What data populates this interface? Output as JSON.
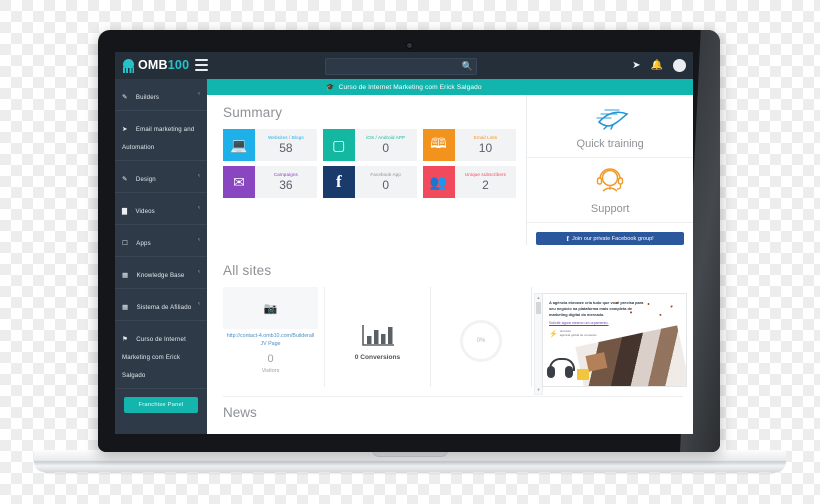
{
  "brand": {
    "name_main": "OMB",
    "name_accent": "100",
    "accent_color": "#25c3c9"
  },
  "topbar": {
    "menu_icon": "hamburger-icon",
    "search_placeholder": "",
    "search_value": "",
    "search_icon": "search-icon",
    "send_icon": "paper-plane-icon",
    "bell_icon": "bell-icon",
    "avatar_icon": "user-avatar-icon"
  },
  "notice": {
    "icon": "graduation-cap-icon",
    "text": "Curso de Internet Marketing com Erick Salgado",
    "bg_color": "#12b5ad"
  },
  "sidebar": {
    "items": [
      {
        "label": "Builders",
        "icon": "pencil-icon",
        "chevron": "‹"
      },
      {
        "label": "Email marketing and Automation",
        "icon": "paper-plane-icon",
        "chevron": ""
      },
      {
        "label": "Design",
        "icon": "pencil-icon",
        "chevron": "‹"
      },
      {
        "label": "Videos",
        "icon": "video-camera-icon",
        "chevron": "‹"
      },
      {
        "label": "Apps",
        "icon": "mobile-icon",
        "chevron": "‹"
      },
      {
        "label": "Knowledge Base",
        "icon": "book-icon",
        "chevron": "‹"
      },
      {
        "label": "Sistema de Afiliado",
        "icon": "building-icon",
        "chevron": "‹"
      },
      {
        "label": "Curso de Internet Marketing com Erick Salgado",
        "icon": "flag-icon",
        "chevron": ""
      }
    ],
    "franchise_button": "Franchise Panel",
    "franchise_color": "#14b5ac"
  },
  "summary": {
    "title": "Summary",
    "cards": [
      {
        "title": "Websites / Blogs",
        "value": "58",
        "icon": "laptop-icon",
        "color": "#1eb0e8",
        "title_color": "#1eb0e8"
      },
      {
        "title": "iOS / Android APP",
        "value": "0",
        "icon": "tablet-icon",
        "color": "#14b8a0",
        "title_color": "#14b8a0"
      },
      {
        "title": "Email Lists",
        "value": "10",
        "icon": "contacts-icon",
        "color": "#f2931e",
        "title_color": "#f2931e"
      },
      {
        "title": "Campaigns",
        "value": "36",
        "icon": "envelope-icon",
        "color": "#8a45c0",
        "title_color": "#8a45c0"
      },
      {
        "title": "Facebook App",
        "value": "0",
        "icon": "facebook-icon",
        "color": "#1a3a6b",
        "title_color": "#8d9196"
      },
      {
        "title": "Unique subscribers",
        "value": "2",
        "icon": "users-icon",
        "color": "#f04a5c",
        "title_color": "#f04a5c"
      }
    ]
  },
  "promo": {
    "quick_training_label": "Quick training",
    "quick_training_icon": "speed-running-icon",
    "support_label": "Support",
    "support_icon": "headset-support-icon",
    "facebook_button": "Join our private Facebook group!",
    "facebook_icon": "facebook-f-icon",
    "facebook_color": "#2b579d"
  },
  "all_sites": {
    "title": "All sites",
    "site": {
      "thumb_icon": "camera-placeholder-icon",
      "link": "http://contact-4.omb10.com/Builderall JV Page",
      "visitors_value": "0",
      "visitors_label": "Visitors"
    },
    "conversions": {
      "icon": "bar-chart-icon",
      "label": "0 Conversions"
    },
    "rate": {
      "value": "0%"
    }
  },
  "ad": {
    "headline": "A agência ebrowze cria tudo que você precisa para seu negócio na plataforma mais completa de marketing digital do mercado.",
    "link": "Solicite agora mesmo um orçamento.",
    "brand_name": "ebrowze",
    "brand_sub": "agência global de conteúdo",
    "scroll_up": "▲",
    "scroll_down": "▼"
  },
  "news": {
    "title": "News"
  }
}
